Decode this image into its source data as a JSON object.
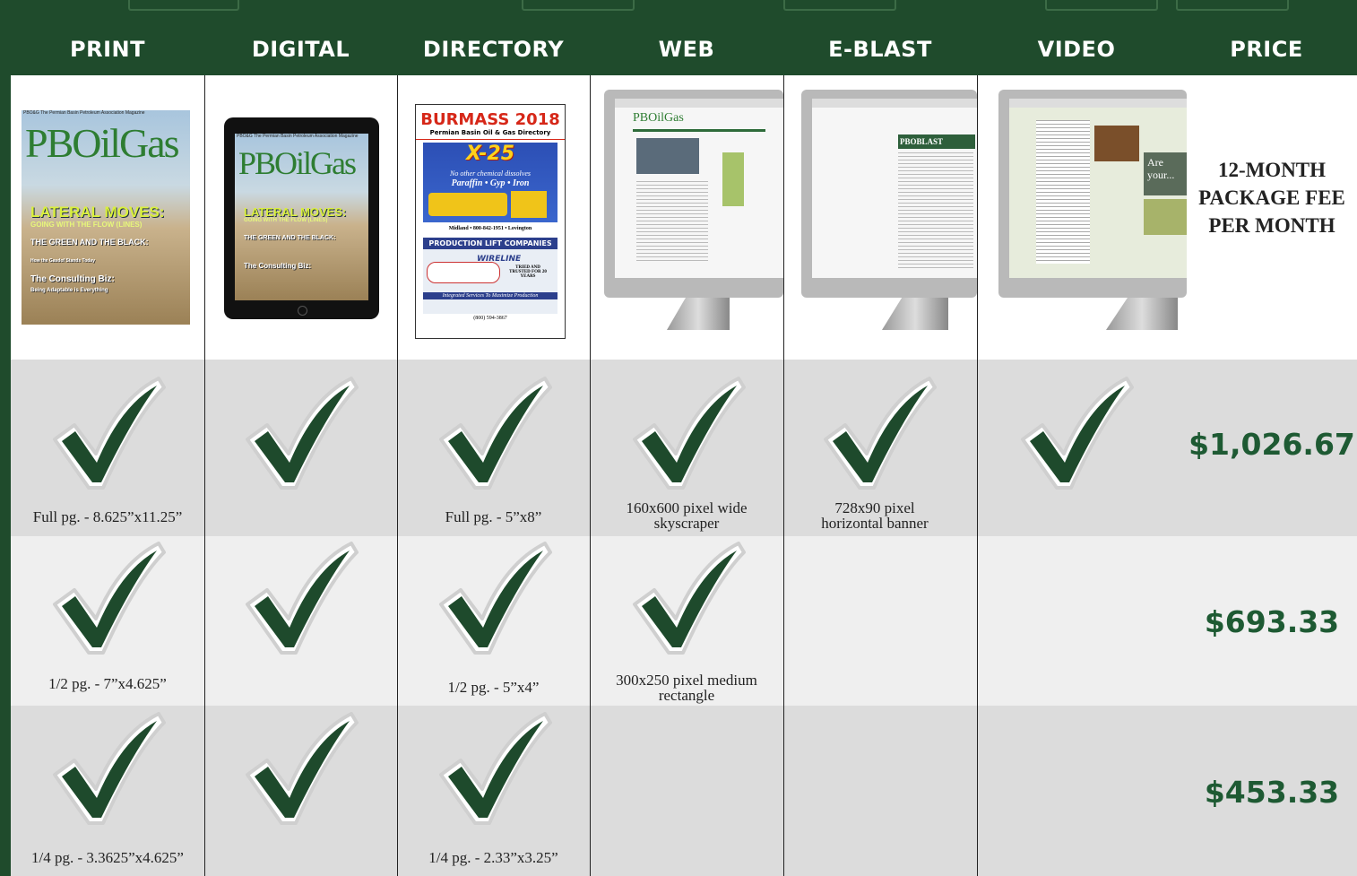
{
  "headers": [
    "PRINT",
    "DIGITAL",
    "DIRECTORY",
    "WEB",
    "E-BLAST",
    "VIDEO",
    "PRICE"
  ],
  "package_label": "12-MONTH PACKAGE FEE PER MONTH",
  "print_mag": {
    "topline": "PBO&G The Permian Basin Petroleum Association Magazine",
    "logo": "PBOilGas",
    "headline": "LATERAL MOVES:",
    "subhead": "GOING WITH THE FLOW (LINES)",
    "story2": "THE GREEN AND THE BLACK:",
    "story2_sub": "How the Gasdof Stands Today",
    "story3": "The Consulting Biz:",
    "story3_sub": "Being Adaptable is Everything"
  },
  "directory": {
    "title": "BURMASS 2018",
    "subtitle": "Permian Basin Oil & Gas Directory",
    "ad1_logo": "X-25",
    "ad1_tagline": "No other chemical dissolves",
    "ad1_items": "Paraffin • Gyp • Iron",
    "ad1_contact": "Midland • 800-842-1951 • Lovington",
    "ad2_title": "PRODUCTION LIFT COMPANIES",
    "ad2_brand": "WIRELINE",
    "ad2_trusted": "TRIED AND TRUSTED FOR 20 YEARS",
    "ad2_tagline": "Integrated Services To Maximize Production",
    "ad2_phone": "(800) 594-3867"
  },
  "web_screen": {
    "logo": "PBOilGas"
  },
  "eblast_screen": {
    "logo": "PBOBLAST"
  },
  "video_screen": {
    "caption": "Are your..."
  },
  "rows": [
    {
      "checks": [
        true,
        true,
        true,
        true,
        true,
        true
      ],
      "captions": [
        "Full pg. - 8.625”x11.25”",
        "",
        "Full pg. - 5”x8”",
        "160x600 pixel wide skyscraper",
        "728x90 pixel horizontal banner",
        ""
      ],
      "price": "$1,026.67"
    },
    {
      "checks": [
        true,
        true,
        true,
        true,
        false,
        false
      ],
      "captions": [
        "1/2 pg. - 7”x4.625”",
        "",
        "1/2 pg. - 5”x4”",
        "300x250 pixel medium rectangle",
        "",
        ""
      ],
      "price": "$693.33"
    },
    {
      "checks": [
        true,
        true,
        true,
        false,
        false,
        false
      ],
      "captions": [
        "1/4 pg. - 3.3625”x4.625”",
        "",
        "1/4 pg. - 2.33”x3.25”",
        "",
        "",
        ""
      ],
      "price": "$453.33"
    }
  ],
  "colors": {
    "header_bg": "#1f4b2c",
    "check": "#1e4a2c",
    "price": "#1e5a33",
    "row_dark": "#dcdcdc",
    "row_light": "#efefef"
  }
}
